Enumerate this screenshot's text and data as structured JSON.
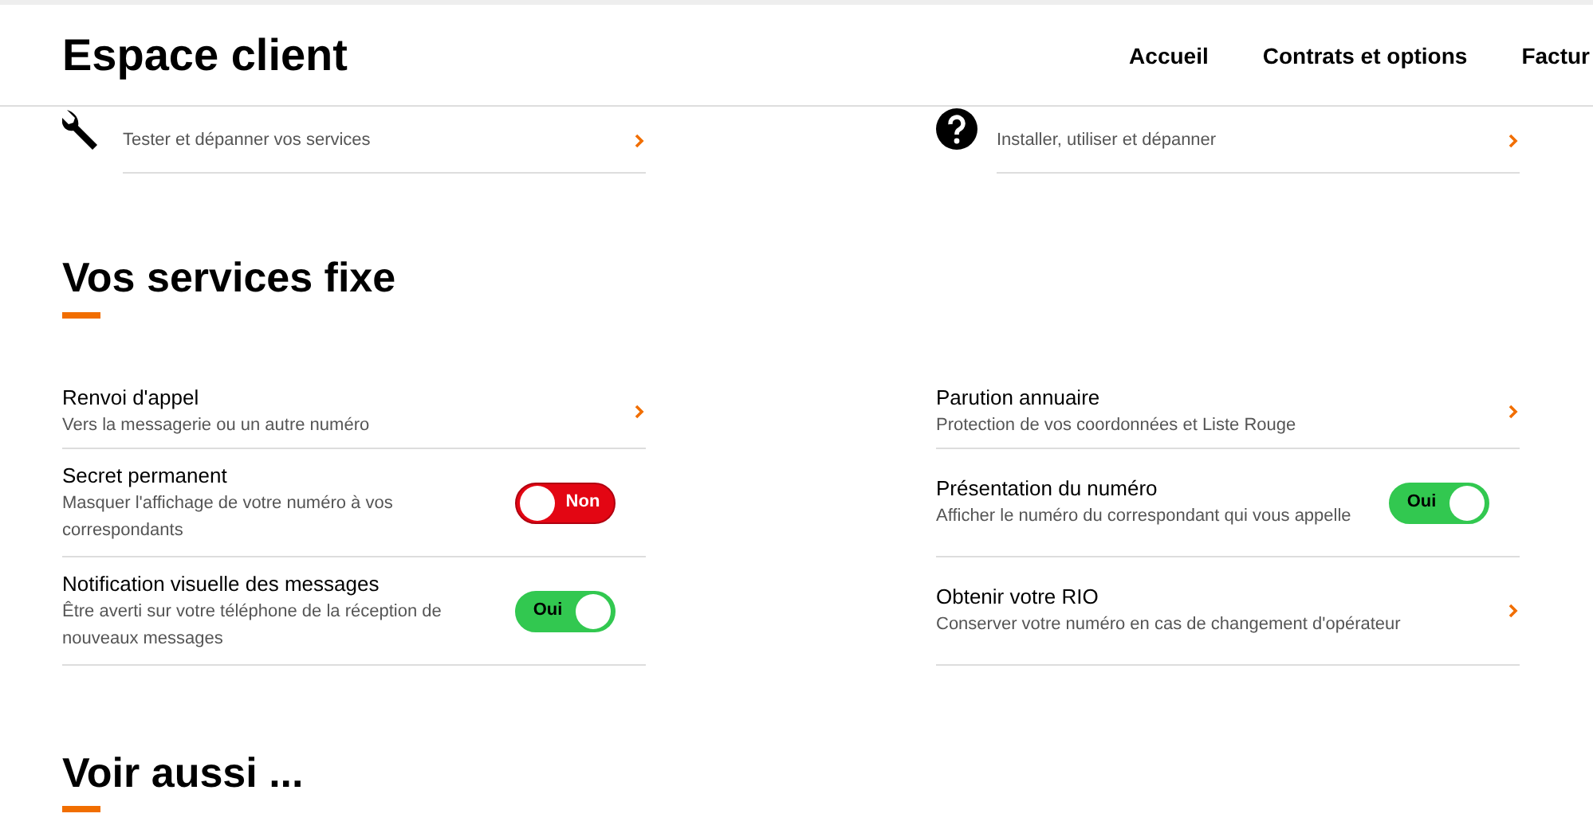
{
  "header": {
    "title": "Espace client",
    "nav": [
      {
        "label": "Accueil"
      },
      {
        "label": "Contrats et options"
      },
      {
        "label": "Factur"
      }
    ]
  },
  "help_links": [
    {
      "subtitle": "Tester et dépanner vos services"
    },
    {
      "subtitle": "Installer, utiliser et dépanner"
    }
  ],
  "services": {
    "heading": "Vos services fixe",
    "left": [
      {
        "kind": "link",
        "title": "Renvoi d'appel",
        "subtitle": "Vers la messagerie ou un autre numéro"
      },
      {
        "kind": "toggle",
        "title": "Secret permanent",
        "subtitle": "Masquer l'affichage de votre numéro à vos correspondants",
        "on": false,
        "label": "Non"
      },
      {
        "kind": "toggle",
        "title": "Notification visuelle des messages",
        "subtitle": "Être averti sur votre téléphone de la réception de nouveaux messages",
        "on": true,
        "label": "Oui"
      }
    ],
    "right": [
      {
        "kind": "link",
        "title": "Parution annuaire",
        "subtitle": "Protection de vos coordonnées et Liste Rouge"
      },
      {
        "kind": "toggle",
        "title": "Présentation du numéro",
        "subtitle": "Afficher le numéro du correspondant qui vous appelle",
        "on": true,
        "label": "Oui"
      },
      {
        "kind": "link",
        "title": "Obtenir votre RIO",
        "subtitle": "Conserver votre numéro en cas de changement d'opérateur"
      }
    ]
  },
  "see_also": {
    "heading": "Voir aussi ..."
  }
}
